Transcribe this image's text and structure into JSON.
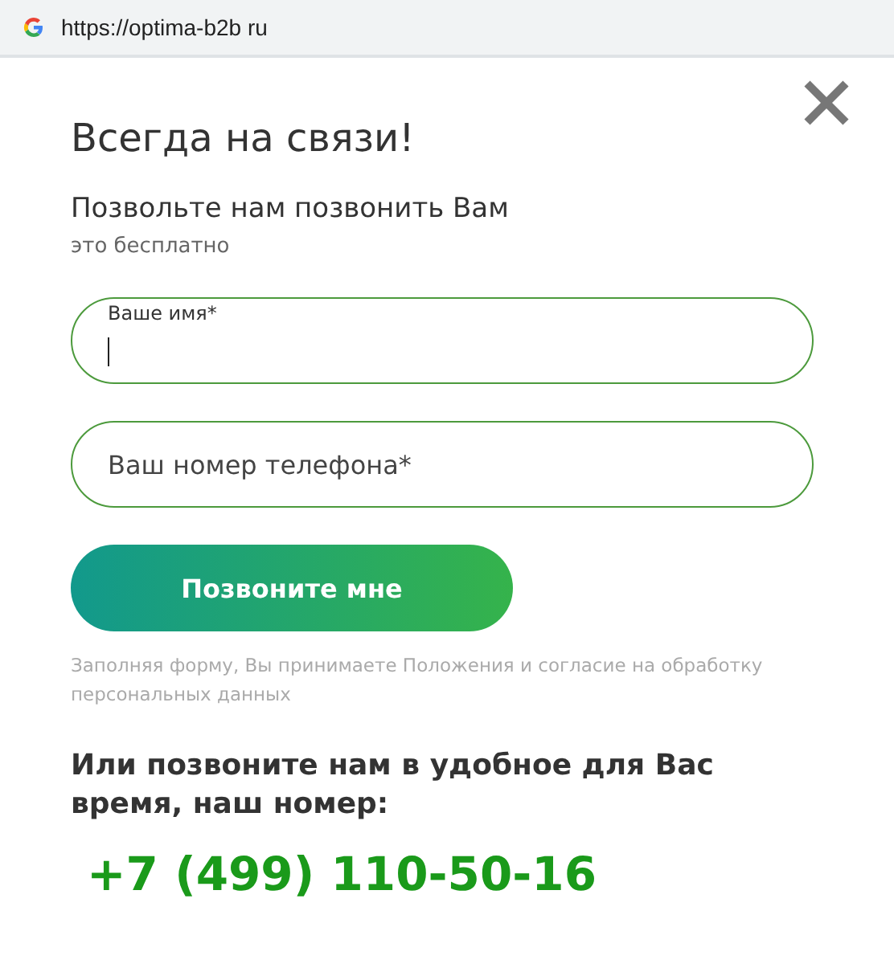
{
  "address_bar": {
    "url": "https://optima-b2b ru"
  },
  "dialog": {
    "title": "Всегда на связи!",
    "subtitle": "Позвольте нам позвонить Вам",
    "note": "это бесплатно",
    "fields": [
      {
        "label": "Ваше имя*",
        "focused": true
      },
      {
        "placeholder": "Ваш номер телефона*",
        "focused": false
      }
    ],
    "submit_button": "Позвоните мне",
    "consent": "Заполняя форму, Вы принимаете Положения и согласие на обработку персональных данных",
    "call_us": "Или позвоните нам в удобное для Вас время, наш номер:",
    "phone": "+7 (499) 110-50-16"
  }
}
